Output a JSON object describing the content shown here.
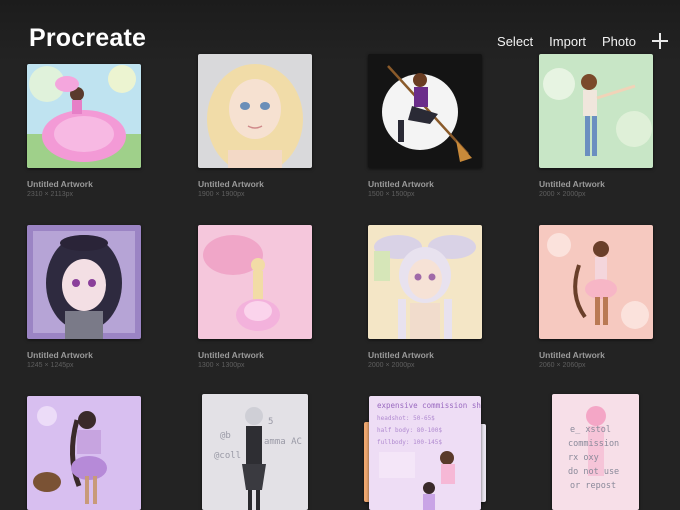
{
  "app": {
    "title": "Procreate"
  },
  "toolbar": {
    "select": "Select",
    "import": "Import",
    "photo": "Photo",
    "add_icon": "plus-icon"
  },
  "artworks": [
    {
      "name": "Untitled Artwork",
      "size": "2310 × 2113px"
    },
    {
      "name": "Untitled Artwork",
      "size": "1900 × 1900px"
    },
    {
      "name": "Untitled Artwork",
      "size": "1500 × 1500px"
    },
    {
      "name": "Untitled Artwork",
      "size": "2000 × 2000px"
    },
    {
      "name": "Untitled Artwork",
      "size": "1245 × 1245px"
    },
    {
      "name": "Untitled Artwork",
      "size": "1300 × 1300px"
    },
    {
      "name": "Untitled Artwork",
      "size": "2000 × 2000px"
    },
    {
      "name": "Untitled Artwork",
      "size": "2060 × 2060px"
    }
  ],
  "bottom_row": {
    "tile10_watermark": [
      "@b",
      "@coll",
      "5",
      "amma AC"
    ],
    "tile11_sheet": {
      "title": "expensive commission sheet",
      "lines": [
        "headshot: 50-65$",
        "half body: 80-100$",
        "fullbody: 100-145$"
      ]
    },
    "tile12_text": [
      "e_ xstol",
      "commission",
      "rx   oxy",
      "do not use",
      "or repost"
    ]
  }
}
